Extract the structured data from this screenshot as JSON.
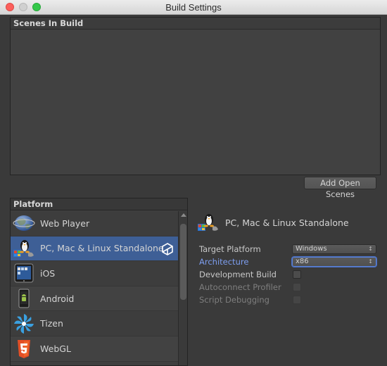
{
  "window": {
    "title": "Build Settings"
  },
  "scenes": {
    "header": "Scenes In Build",
    "add_button": "Add Open Scenes"
  },
  "platform": {
    "header": "Platform",
    "items": [
      {
        "label": "Web Player",
        "icon": "globe-icon"
      },
      {
        "label": "PC, Mac & Linux Standalone",
        "icon": "pc-standalone-icon",
        "selected": true
      },
      {
        "label": "iOS",
        "icon": "ipad-icon"
      },
      {
        "label": "Android",
        "icon": "android-icon"
      },
      {
        "label": "Tizen",
        "icon": "tizen-icon"
      },
      {
        "label": "WebGL",
        "icon": "html5-icon"
      }
    ]
  },
  "settings": {
    "title": "PC, Mac & Linux Standalone",
    "target_platform": {
      "label": "Target Platform",
      "value": "Windows"
    },
    "architecture": {
      "label": "Architecture",
      "value": "x86"
    },
    "development_build": {
      "label": "Development Build",
      "checked": false
    },
    "autoconnect_profiler": {
      "label": "Autoconnect Profiler",
      "checked": false
    },
    "script_debugging": {
      "label": "Script Debugging",
      "checked": false
    }
  },
  "colors": {
    "selection": "#3e5f96",
    "focus_label": "#7d9ef0",
    "panel_bg": "#3a3a3a"
  }
}
